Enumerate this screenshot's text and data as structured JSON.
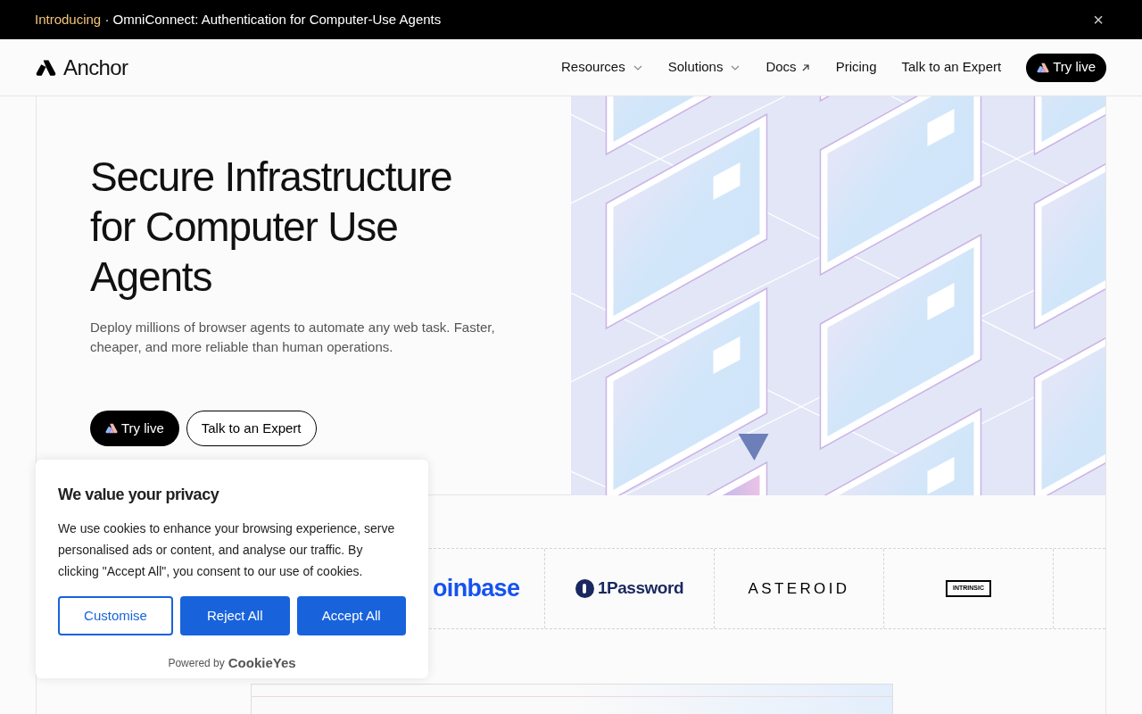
{
  "announcement": {
    "highlight": "Introducing",
    "separator": "·",
    "text": "OmniConnect: Authentication for Computer-Use Agents",
    "close": "×"
  },
  "nav": {
    "brand": "Anchor",
    "items": [
      {
        "label": "Resources",
        "kind": "dropdown"
      },
      {
        "label": "Solutions",
        "kind": "dropdown"
      },
      {
        "label": "Docs",
        "kind": "external"
      },
      {
        "label": "Pricing",
        "kind": "link"
      },
      {
        "label": "Talk to an Expert",
        "kind": "link"
      }
    ],
    "cta": "Try live"
  },
  "hero": {
    "title": "Secure Infrastructure for Computer Use Agents",
    "subtitle": "Deploy millions of browser agents to automate any web task. Faster, cheaper, and more reliable than human operations.",
    "buttons": [
      {
        "label": "Try live",
        "kind": "primary"
      },
      {
        "label": "Talk to an Expert",
        "kind": "secondary"
      }
    ]
  },
  "logos": [
    {
      "name": "oinbase",
      "kind": "coinbase"
    },
    {
      "name": "1Password",
      "kind": "onepassword"
    },
    {
      "name": "ASTEROID",
      "kind": "asteroid"
    },
    {
      "name": "INTRINSIC",
      "kind": "intrinsic"
    }
  ],
  "cookie_banner": {
    "title": "We value your privacy",
    "body": "We use cookies to enhance your browsing experience, serve personalised ads or content, and analyse our traffic. By clicking \"Accept All\", you consent to our use of cookies.",
    "buttons": [
      {
        "label": "Customise",
        "kind": "outline"
      },
      {
        "label": "Reject All",
        "kind": "solid"
      },
      {
        "label": "Accept All",
        "kind": "solid"
      }
    ],
    "powered_by": "Powered by",
    "provider": "CookieYes"
  }
}
